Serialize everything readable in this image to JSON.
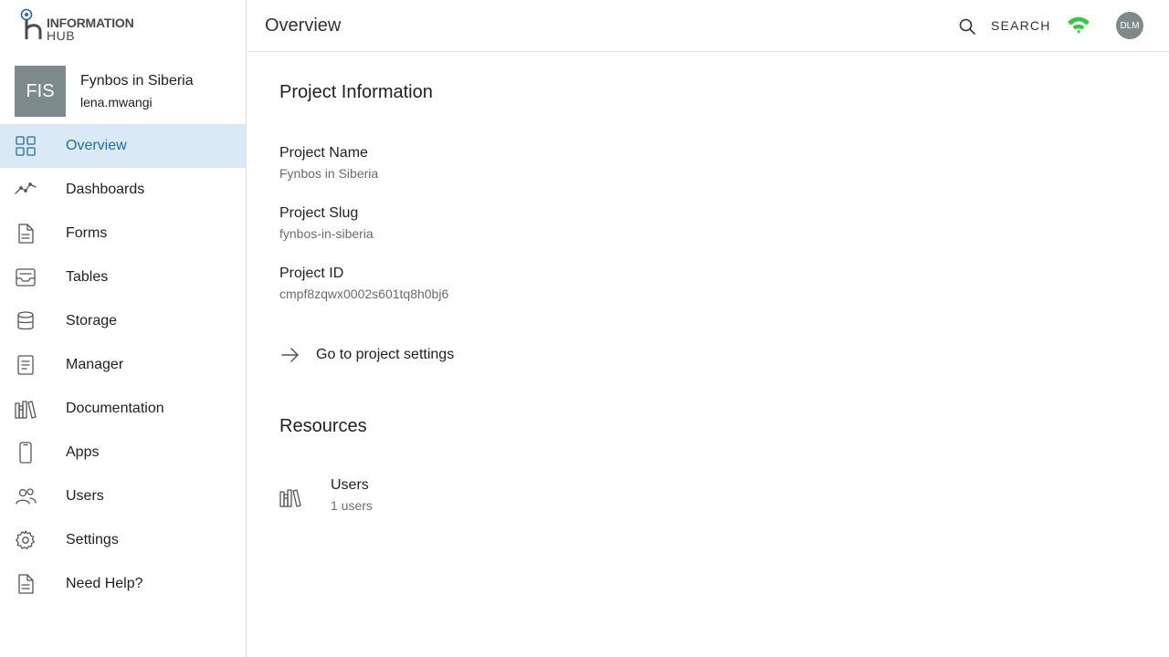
{
  "brand": {
    "logo_line1": "INFORMATION",
    "logo_line2": "HUB"
  },
  "project_card": {
    "initials": "FIS",
    "name": "Fynbos in Siberia",
    "user": "lena.mwangi"
  },
  "sidebar": {
    "items": [
      {
        "label": "Overview",
        "icon": "grid-icon",
        "active": true
      },
      {
        "label": "Dashboards",
        "icon": "trend-line-icon"
      },
      {
        "label": "Forms",
        "icon": "document-icon"
      },
      {
        "label": "Tables",
        "icon": "inbox-tray-icon"
      },
      {
        "label": "Storage",
        "icon": "database-icon"
      },
      {
        "label": "Manager",
        "icon": "clipboard-icon"
      },
      {
        "label": "Documentation",
        "icon": "books-icon"
      },
      {
        "label": "Apps",
        "icon": "phone-icon"
      },
      {
        "label": "Users",
        "icon": "users-icon"
      },
      {
        "label": "Settings",
        "icon": "gear-icon"
      },
      {
        "label": "Need Help?",
        "icon": "help-document-icon"
      }
    ]
  },
  "header": {
    "title": "Overview",
    "search_label": "SEARCH",
    "user_initials": "DLM",
    "accent_wifi": "#2ecc40"
  },
  "main": {
    "project_info_title": "Project Information",
    "fields": [
      {
        "label": "Project Name",
        "value": "Fynbos in Siberia"
      },
      {
        "label": "Project Slug",
        "value": "fynbos-in-siberia"
      },
      {
        "label": "Project ID",
        "value": "cmpf8zqwx0002s601tq8h0bj6"
      }
    ],
    "settings_link": "Go to project settings",
    "resources_title": "Resources",
    "resources": [
      {
        "title": "Users",
        "subtitle": "1 users",
        "icon": "books-icon"
      }
    ]
  },
  "colors": {
    "active_bg": "#d9e9f5",
    "active_text": "#1a6fa8",
    "avatar_bg": "#7d8a8a"
  }
}
